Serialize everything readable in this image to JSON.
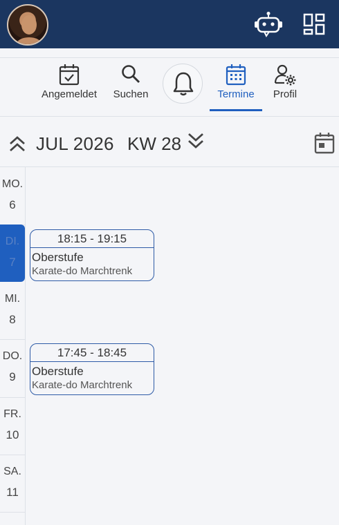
{
  "header": {
    "avatar_icon": "user-avatar",
    "bot_icon": "chatbot-icon",
    "apps_icon": "dashboard-grid-icon",
    "bg_color": "#1b3660"
  },
  "nav": {
    "items": [
      {
        "label": "Angemeldet",
        "icon": "calendar-check-icon"
      },
      {
        "label": "Suchen",
        "icon": "search-icon"
      },
      {
        "label": "",
        "icon": "bell-icon"
      },
      {
        "label": "Termine",
        "icon": "calendar-grid-icon",
        "active": true
      },
      {
        "label": "Profil",
        "icon": "user-settings-icon"
      }
    ],
    "accent": "#1f5fbf"
  },
  "week": {
    "month": "JUL 2026",
    "kw": "KW 28"
  },
  "days": [
    {
      "name": "MO.",
      "num": "6"
    },
    {
      "name": "DI.",
      "num": "7",
      "today": true
    },
    {
      "name": "MI.",
      "num": "8"
    },
    {
      "name": "DO.",
      "num": "9"
    },
    {
      "name": "FR.",
      "num": "10"
    },
    {
      "name": "SA.",
      "num": "11"
    }
  ],
  "events": [
    {
      "day": "DI.",
      "time": "18:15 - 19:15",
      "title": "Oberstufe",
      "club": "Karate-do Marchtrenk"
    },
    {
      "day": "DO.",
      "time": "17:45 - 18:45",
      "title": "Oberstufe",
      "club": "Karate-do Marchtrenk"
    }
  ]
}
